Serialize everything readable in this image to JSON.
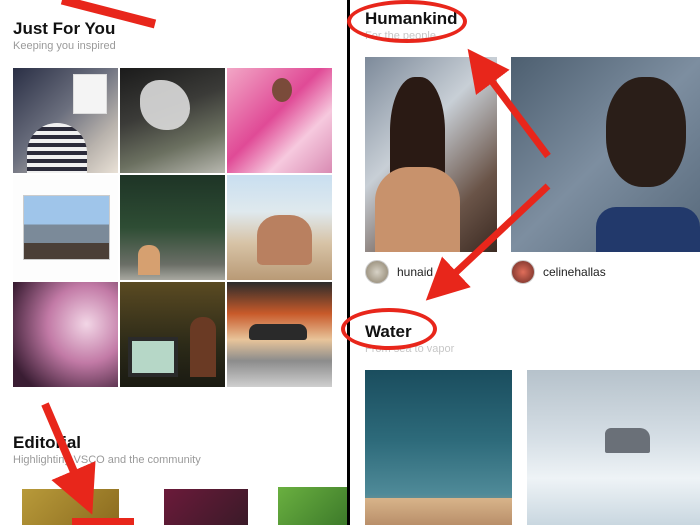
{
  "left": {
    "section1": {
      "title": "Just For You",
      "subtitle": "Keeping you inspired"
    },
    "section2": {
      "title": "Editorial",
      "subtitle": "Highlighting VSCO and the community"
    }
  },
  "right": {
    "section1": {
      "title": "Humankind",
      "subtitle": "For the people"
    },
    "users": [
      {
        "name": "hunaid"
      },
      {
        "name": "celinehallas"
      }
    ],
    "section2": {
      "title": "Water",
      "subtitle": "From sea to vapor"
    }
  },
  "colors": {
    "annotation": "#e8261b"
  }
}
